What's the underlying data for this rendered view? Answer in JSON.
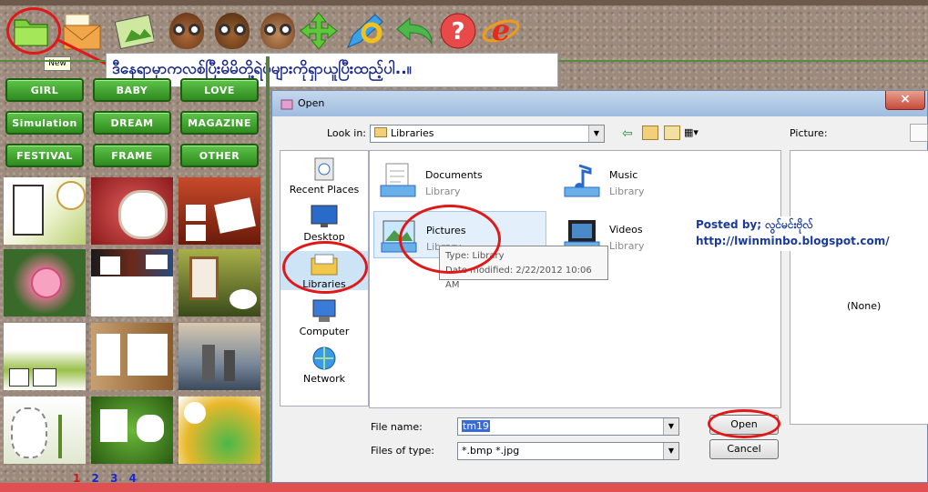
{
  "toolbar": {
    "new_tooltip": "New",
    "icons": [
      "folder-icon",
      "envelope-icon",
      "picture-icon",
      "owl-icon",
      "owl-icon",
      "owl-icon",
      "move-icon",
      "pencil-icon",
      "undo-icon",
      "help-icon",
      "ie-icon"
    ]
  },
  "callout": {
    "text": "ဒီနေရာမှာကလစ်ပြီးမိမိတို့ရဲပုံများကိုရှာယူပြီးထည့်ပါ..။"
  },
  "categories": [
    "GIRL",
    "BABY",
    "LOVE",
    "Simulation",
    "DREAM",
    "MAGAZINE",
    "FESTIVAL",
    "FRAME",
    "OTHER"
  ],
  "pager": {
    "current": "1",
    "pages": [
      "2",
      "3",
      "4"
    ]
  },
  "dialog": {
    "title": "Open",
    "close": "×",
    "look_in_label": "Look in:",
    "look_in_value": "Libraries",
    "places": [
      "Recent Places",
      "Desktop",
      "Libraries",
      "Computer",
      "Network"
    ],
    "items": [
      {
        "name": "Documents",
        "sub": "Library"
      },
      {
        "name": "Music",
        "sub": "Library"
      },
      {
        "name": "Pictures",
        "sub": "Library"
      },
      {
        "name": "Videos",
        "sub": "Library"
      }
    ],
    "tooltip": {
      "line1": "Type: Library",
      "line2": "Date modified: 2/22/2012 10:06 AM"
    },
    "picture_label": "Picture:",
    "picture_none": "(None)",
    "filename_label": "File name:",
    "filename_value": "tm19",
    "filetype_label": "Files of type:",
    "filetype_value": "*.bmp *.jpg",
    "open_button": "Open",
    "cancel_button": "Cancel"
  },
  "posted": {
    "line1": "Posted by;  လွင်မင်းဗိုလ်",
    "line2": "http://lwinminbo.blogspot.com/"
  },
  "colors": {
    "accent_red": "#e01818",
    "button_green": "#3aa52a",
    "link_blue": "#1a3a9a"
  }
}
